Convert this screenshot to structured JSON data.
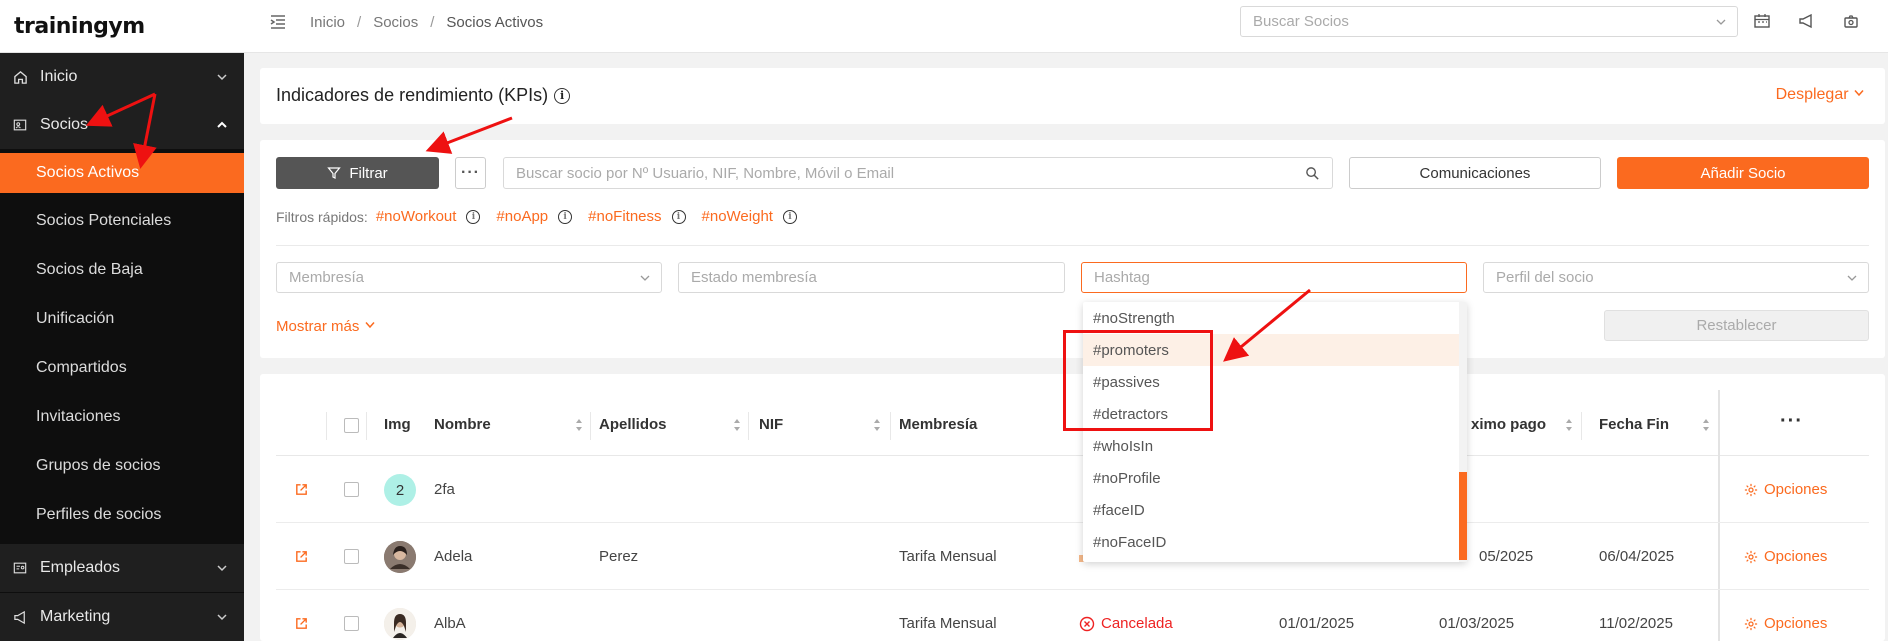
{
  "app": {
    "logo": "trainingym"
  },
  "sidebar": {
    "items": [
      {
        "label": "Inicio",
        "icon": "home-icon"
      },
      {
        "label": "Socios",
        "icon": "id-card-icon"
      },
      {
        "label": "Socios Activos"
      },
      {
        "label": "Socios Potenciales"
      },
      {
        "label": "Socios de Baja"
      },
      {
        "label": "Unificación"
      },
      {
        "label": "Compartidos"
      },
      {
        "label": "Invitaciones"
      },
      {
        "label": "Grupos de socios"
      },
      {
        "label": "Perfiles de socios"
      },
      {
        "label": "Empleados",
        "icon": "id-badge-icon"
      },
      {
        "label": "Marketing",
        "icon": "megaphone-icon"
      }
    ]
  },
  "header": {
    "breadcrumb": [
      "Inicio",
      "Socios",
      "Socios Activos"
    ],
    "search_placeholder": "Buscar Socios"
  },
  "kpi": {
    "title": "Indicadores de rendimiento (KPIs)",
    "expand_label": "Desplegar"
  },
  "filters": {
    "filter_button": "Filtrar",
    "more_button": "···",
    "search_placeholder": "Buscar socio por Nº Usuario, NIF, Nombre, Móvil o Email",
    "communications_button": "Comunicaciones",
    "add_button": "Añadir Socio",
    "quick_label": "Filtros rápidos:",
    "quick_tags": [
      "#noWorkout",
      "#noApp",
      "#noFitness",
      "#noWeight"
    ],
    "selects": [
      "Membresía",
      "Estado membresía",
      "Hashtag",
      "Perfil del socio"
    ],
    "show_more": "Mostrar más",
    "reset_button": "Restablecer"
  },
  "hashtag_dropdown": {
    "options": [
      "#noStrength",
      "#promoters",
      "#passives",
      "#detractors",
      "#whoIsIn",
      "#noProfile",
      "#faceID",
      "#noFaceID"
    ],
    "highlighted_index": 1
  },
  "table": {
    "columns": [
      "Img",
      "Nombre",
      "Apellidos",
      "NIF",
      "Membresía",
      "ximo pago",
      "Fecha Fin"
    ],
    "menu_label": "···",
    "options_label": "Opciones",
    "rows": [
      {
        "avatar_text": "2",
        "nombre": "2fa",
        "apellidos": "",
        "membresia": "",
        "status": "",
        "col1": "",
        "col2": "",
        "fecha_fin": ""
      },
      {
        "avatar_text": "",
        "nombre": "Adela",
        "apellidos": "Perez",
        "membresia": "Tarifa Mensual",
        "status": "",
        "col1": "",
        "col2": "05/2025",
        "fecha_fin": "06/04/2025"
      },
      {
        "avatar_text": "",
        "nombre": "AlbA",
        "apellidos": "",
        "membresia": "Tarifa Mensual",
        "status": "Cancelada",
        "col1": "01/01/2025",
        "col2": "01/03/2025",
        "fecha_fin": "11/02/2025"
      }
    ]
  },
  "colors": {
    "accent": "#fb6a1f",
    "sidebar_bg": "#0e0e0e",
    "annotation_red": "#ee1111"
  }
}
